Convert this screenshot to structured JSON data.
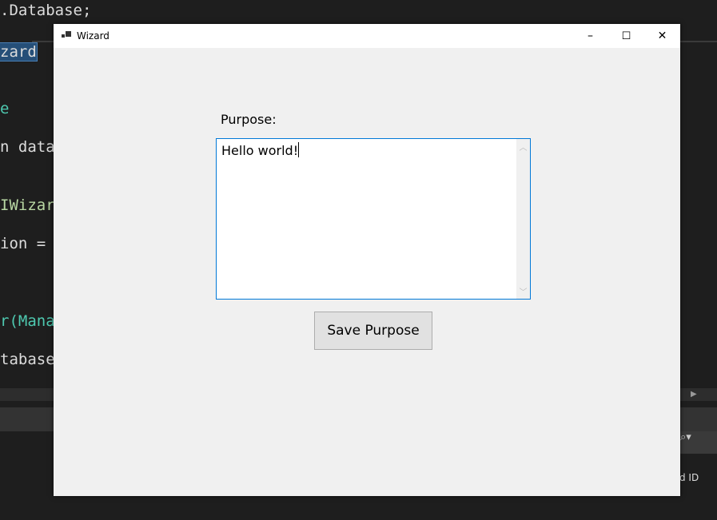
{
  "background_editor": {
    "lines": [
      ".Database;",
      "zard",
      "e",
      "n datab",
      "IWizard",
      "ion = c",
      "r(Manag",
      "tabase(",
      "ged ID"
    ]
  },
  "window": {
    "title": "Wizard",
    "minimize": "–",
    "maximize": "☐",
    "close": "✕"
  },
  "form": {
    "purpose_label": "Purpose:",
    "purpose_value": "Hello world!",
    "save_button": "Save Purpose"
  },
  "colors": {
    "accent": "#0078d7"
  }
}
